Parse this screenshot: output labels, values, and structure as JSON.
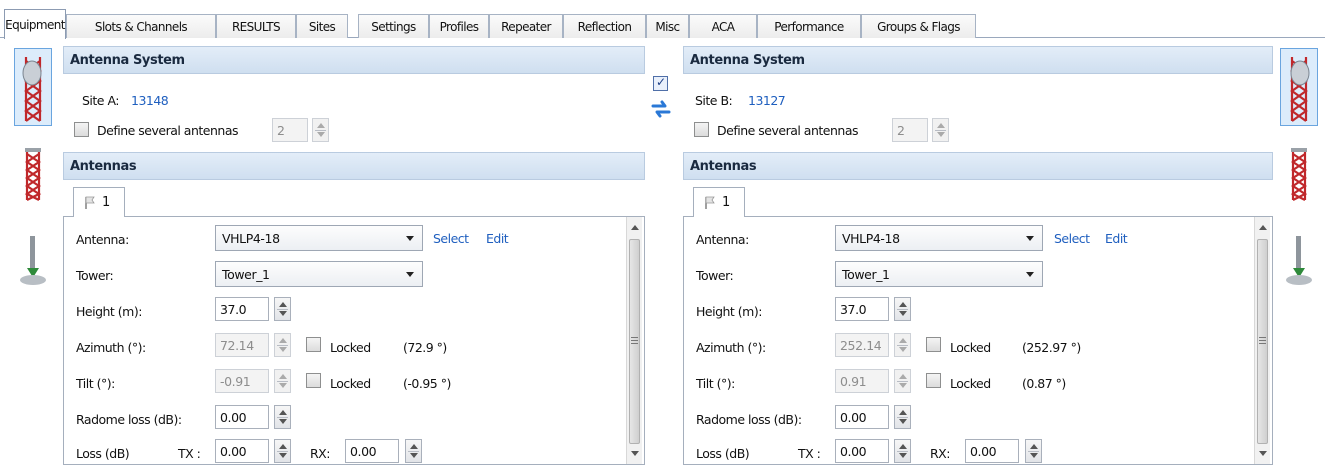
{
  "tabs": [
    "Equipment",
    "Slots & Channels",
    "RESULTS",
    "Sites",
    "Settings",
    "Profiles",
    "Repeater",
    "Reflection",
    "Misc",
    "ACA",
    "Performance",
    "Groups & Flags"
  ],
  "left": {
    "section_title": "Antenna System",
    "site_label": "Site A:",
    "site_id": "13148",
    "define_label": "Define several antennas",
    "define_count": "2",
    "antennas_title": "Antennas",
    "subtab": "1",
    "antenna_label": "Antenna:",
    "antenna_value": "VHLP4-18",
    "select_link": "Select",
    "edit_link": "Edit",
    "tower_label": "Tower:",
    "tower_value": "Tower_1",
    "height_label": "Height (m):",
    "height_value": "37.0",
    "azimuth_label": "Azimuth (°):",
    "azimuth_value": "72.14",
    "azimuth_locked": "Locked",
    "azimuth_calc": "(72.9 °)",
    "tilt_label": "Tilt (°):",
    "tilt_value": "-0.91",
    "tilt_locked": "Locked",
    "tilt_calc": "(-0.95 °)",
    "radome_label": "Radome loss (dB):",
    "radome_value": "0.00",
    "loss_label": "Loss (dB)",
    "tx_label": "TX :",
    "tx_value": "0.00",
    "rx_label": "RX:",
    "rx_value": "0.00"
  },
  "right": {
    "section_title": "Antenna System",
    "site_label": "Site B:",
    "site_id": "13127",
    "define_label": "Define several antennas",
    "define_count": "2",
    "antennas_title": "Antennas",
    "subtab": "1",
    "antenna_label": "Antenna:",
    "antenna_value": "VHLP4-18",
    "select_link": "Select",
    "edit_link": "Edit",
    "tower_label": "Tower:",
    "tower_value": "Tower_1",
    "height_label": "Height (m):",
    "height_value": "37.0",
    "azimuth_label": "Azimuth (°):",
    "azimuth_value": "252.14",
    "azimuth_locked": "Locked",
    "azimuth_calc": "(252.97 °)",
    "tilt_label": "Tilt (°):",
    "tilt_value": "0.91",
    "tilt_locked": "Locked",
    "tilt_calc": "(0.87 °)",
    "radome_label": "Radome loss (dB):",
    "radome_value": "0.00",
    "loss_label": "Loss (dB)",
    "tx_label": "TX :",
    "tx_value": "0.00",
    "rx_label": "RX:",
    "rx_value": "0.00"
  },
  "icons": {
    "tower_selected": "lattice-tower-dish-icon",
    "tower": "lattice-tower-icon",
    "mast": "ground-mast-icon",
    "link_checkbox": "checkbox-checked-icon",
    "swap": "swap-arrows-icon",
    "subtab_flag": "flag-icon"
  },
  "colors": {
    "header_bg": "#d6e4f3",
    "link": "#1f5fbf",
    "selected_icon_bg": "#dcecfb"
  }
}
